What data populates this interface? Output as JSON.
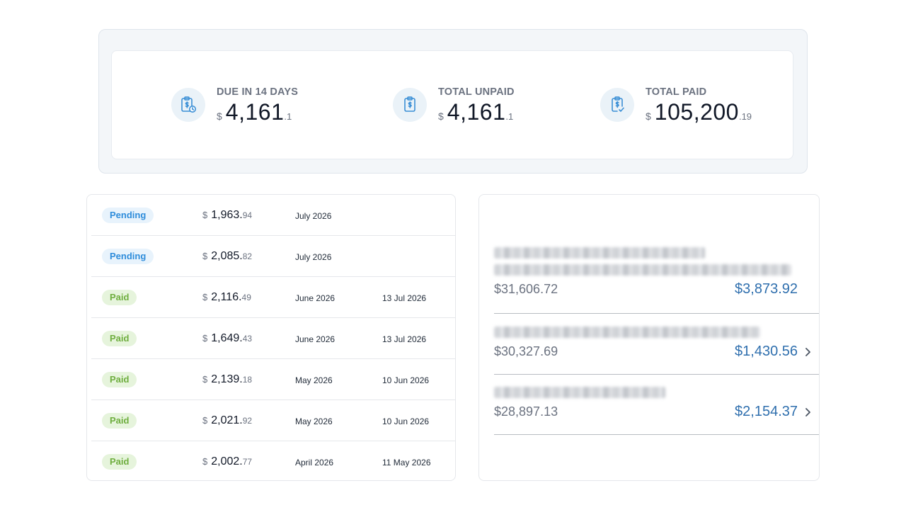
{
  "summary": {
    "due": {
      "label": "DUE IN 14 DAYS",
      "currency": "$",
      "whole": "4,161",
      "cents": ".1",
      "icon": "clipboard-clock-icon"
    },
    "unpaid": {
      "label": "TOTAL UNPAID",
      "currency": "$",
      "whole": "4,161",
      "cents": ".1",
      "icon": "clipboard-dollar-icon"
    },
    "paid": {
      "label": "TOTAL PAID",
      "currency": "$",
      "whole": "105,200",
      "cents": ".19",
      "icon": "clipboard-check-icon"
    }
  },
  "invoices": [
    {
      "status": "Pending",
      "currency": "$",
      "whole": "1,963.",
      "cents": "94",
      "period": "July 2026",
      "paid_on": ""
    },
    {
      "status": "Pending",
      "currency": "$",
      "whole": "2,085.",
      "cents": "82",
      "period": "July 2026",
      "paid_on": ""
    },
    {
      "status": "Paid",
      "currency": "$",
      "whole": "2,116.",
      "cents": "49",
      "period": "June 2026",
      "paid_on": "13 Jul 2026"
    },
    {
      "status": "Paid",
      "currency": "$",
      "whole": "1,649.",
      "cents": "43",
      "period": "June 2026",
      "paid_on": "13 Jul 2026"
    },
    {
      "status": "Paid",
      "currency": "$",
      "whole": "2,139.",
      "cents": "18",
      "period": "May 2026",
      "paid_on": "10 Jun 2026"
    },
    {
      "status": "Paid",
      "currency": "$",
      "whole": "2,021.",
      "cents": "92",
      "period": "May 2026",
      "paid_on": "10 Jun 2026"
    },
    {
      "status": "Paid",
      "currency": "$",
      "whole": "2,002.",
      "cents": "77",
      "period": "April 2026",
      "paid_on": "11 May 2026"
    }
  ],
  "items": [
    {
      "total": "$31,606.72",
      "amount": "$3,873.92",
      "chevron": false
    },
    {
      "total": "$30,327.69",
      "amount": "$1,430.56",
      "chevron": true
    },
    {
      "total": "$28,897.13",
      "amount": "$2,154.37",
      "chevron": true
    }
  ],
  "colors": {
    "pending_badge_text": "#2f8ddb",
    "pending_badge_bg": "#e8f3fc",
    "paid_badge_text": "#6fae3f",
    "paid_badge_bg": "#e6f4dc",
    "link_amount": "#2f6fae",
    "icon_accent": "#3b8fd6"
  }
}
